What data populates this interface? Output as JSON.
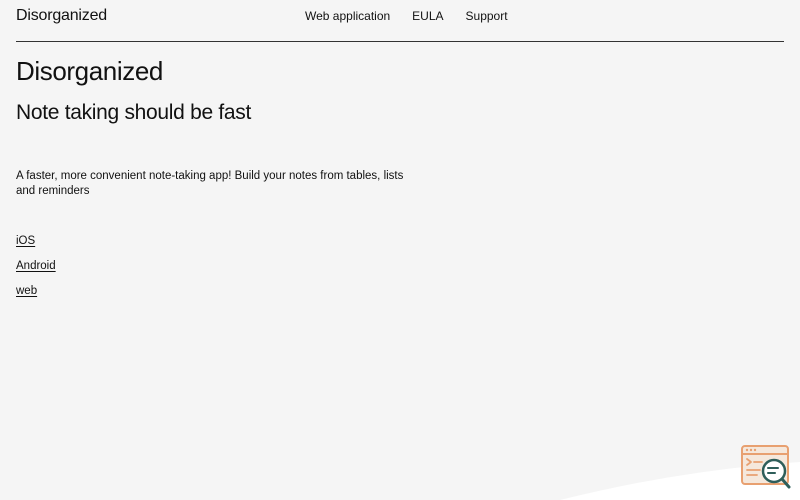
{
  "header": {
    "brand": "Disorganized",
    "nav": [
      {
        "label": "Web application"
      },
      {
        "label": "EULA"
      },
      {
        "label": "Support"
      }
    ]
  },
  "main": {
    "title": "Disorganized",
    "subtitle": "Note taking should be fast",
    "description": "A faster, more convenient note-taking app! Build your notes from tables, lists and reminders",
    "links": [
      {
        "label": "iOS"
      },
      {
        "label": "Android"
      },
      {
        "label": "web"
      }
    ]
  },
  "colors": {
    "background": "#f5f5f5",
    "text": "#111111",
    "divider": "#333333",
    "badge_orange": "#e8a070",
    "badge_teal": "#2e5e5a"
  },
  "icons": {
    "badge": "search-window-icon"
  }
}
